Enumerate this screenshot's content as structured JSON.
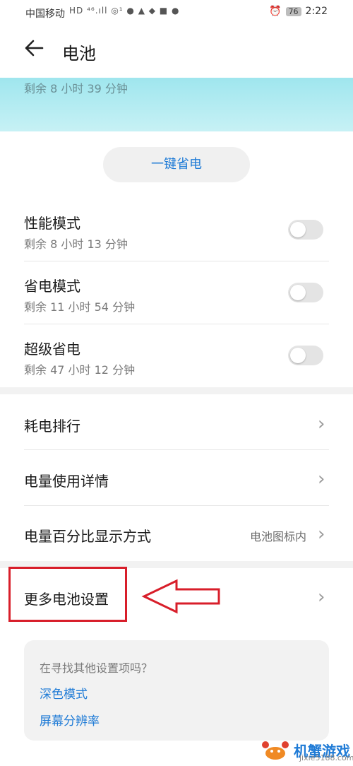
{
  "status_bar": {
    "carrier": "中国移动",
    "icons": "HD ⁴⁶.ıll ◎¹ ● ▲ ◆ ■ ●",
    "battery": "76",
    "time": "2:22"
  },
  "header": {
    "title": "电池"
  },
  "banner": {
    "remaining": "剩余 8 小时 39 分钟"
  },
  "save_button": "一键省电",
  "modes": [
    {
      "title": "性能模式",
      "sub": "剩余 8 小时 13 分钟",
      "on": false
    },
    {
      "title": "省电模式",
      "sub": "剩余 11 小时 54 分钟",
      "on": false
    },
    {
      "title": "超级省电",
      "sub": "剩余 47 小时 12 分钟",
      "on": false
    }
  ],
  "rows": [
    {
      "label": "耗电排行"
    },
    {
      "label": "电量使用详情"
    },
    {
      "label": "电量百分比显示方式",
      "value": "电池图标内"
    },
    {
      "label": "更多电池设置"
    }
  ],
  "suggest": {
    "question": "在寻找其他设置项吗？",
    "links": [
      "深色模式",
      "屏幕分辨率"
    ]
  },
  "watermark": {
    "name": "机蟹游戏",
    "url": "jixie5188.com"
  },
  "colors": {
    "accent": "#1f7bd6",
    "highlight": "#d81e2a",
    "banner": "#b0ecf2"
  }
}
